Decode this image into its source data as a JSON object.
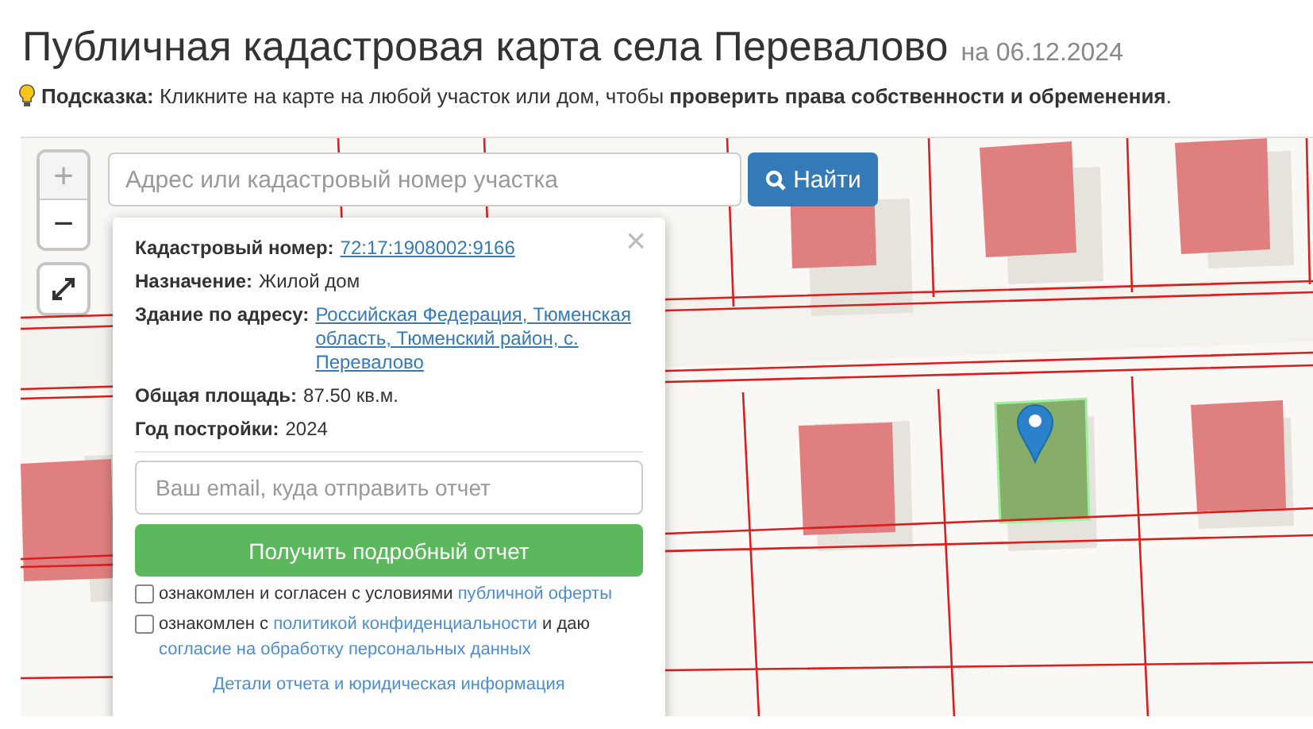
{
  "title": "Публичная кадастровая карта села Перевалово",
  "date": "на 06.12.2024",
  "hint": "**Подсказка:** Кликните на карте на любой участок или дом, чтобы **проверить права собственности и обременения**.",
  "map": {
    "kind": "picture",
    "zoom_in": "+",
    "zoom_out": "−",
    "search_placeholder": "Адрес или кадастровый номер участка",
    "search_button": "Найти"
  },
  "popup": {
    "close": "×",
    "fields": [
      {
        "label": "Кадастровый номер:",
        "value": "72:17:1908002:9166",
        "link": true
      },
      {
        "label": "Назначение:",
        "value": "Жилой дом",
        "link": false
      },
      {
        "label": "Здание по адресу:",
        "value": "Российская Федерация, Тюменская область, Тюменский район, с. Перевалово",
        "link": true
      },
      {
        "label": "Общая площадь:",
        "value": "87.50 кв.м.",
        "link": false
      },
      {
        "label": "Год постройки:",
        "value": "2024",
        "link": false
      }
    ],
    "email_placeholder": "Ваш email, куда отправить отчет",
    "submit": "Получить подробный отчет",
    "consents": [
      {
        "checked": false,
        "parts": [
          {
            "text": "ознакомлен и согласен с условиями ",
            "link": false
          },
          {
            "text": "публичной оферты",
            "link": true
          }
        ]
      },
      {
        "checked": false,
        "parts": [
          {
            "text": "ознакомлен с ",
            "link": false
          },
          {
            "text": "политикой конфиденциальности",
            "link": true
          },
          {
            "text": " и даю ",
            "link": false
          },
          {
            "text": "согласие на обработку персональных данных",
            "link": true
          }
        ]
      }
    ],
    "footer_link": "Детали отчета и юридическая информация"
  }
}
